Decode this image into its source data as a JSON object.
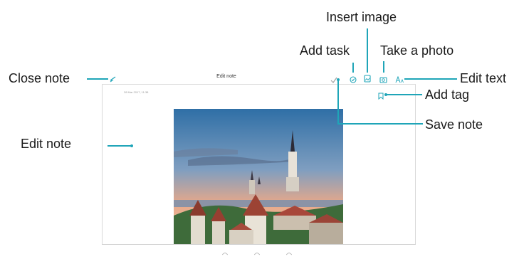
{
  "toolbar": {
    "title": "Edit note"
  },
  "note": {
    "date": "28 Mar 2017, 11:38"
  },
  "callouts": {
    "insert_image": "Insert image",
    "add_task": "Add task",
    "take_photo": "Take a photo",
    "close_note": "Close note",
    "edit_text": "Edit text",
    "add_tag": "Add tag",
    "edit_note": "Edit note",
    "save_note": "Save note"
  },
  "icons": {
    "close": "close-icon",
    "save": "checkmark-icon",
    "task": "task-icon",
    "image": "image-icon",
    "camera": "camera-icon",
    "text": "text-format-icon",
    "tag": "bookmark-icon"
  },
  "colors": {
    "accent": "#1fa5b8",
    "save_icon": "#a0a0a0"
  }
}
